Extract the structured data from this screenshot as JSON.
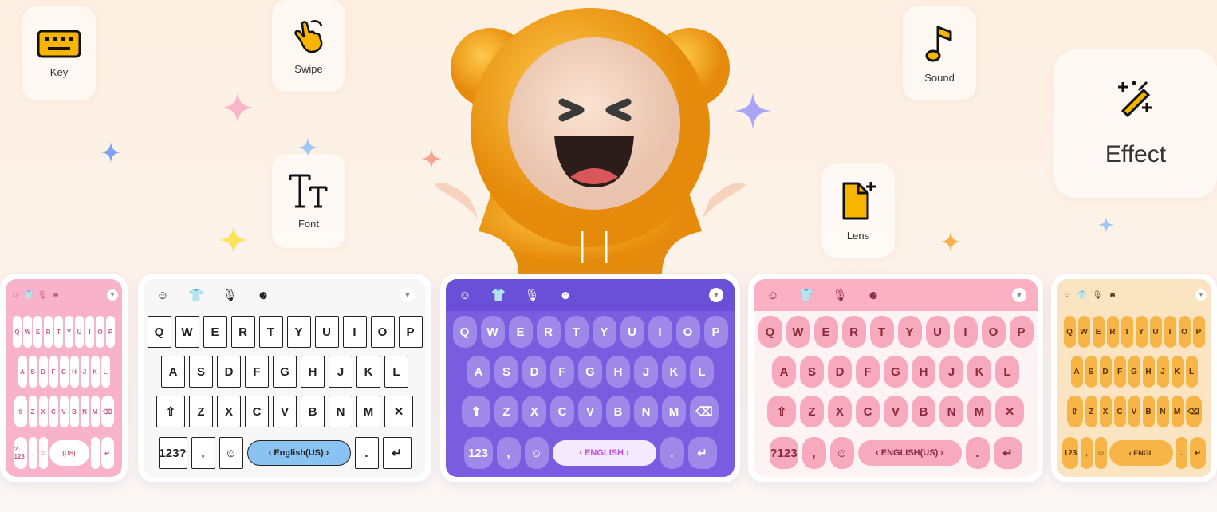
{
  "features": [
    {
      "label": "Key",
      "icon": "keyboard-icon"
    },
    {
      "label": "Swipe",
      "icon": "swipe-hand-icon"
    },
    {
      "label": "Font",
      "icon": "font-icon"
    },
    {
      "label": "Sound",
      "icon": "music-note-icon"
    },
    {
      "label": "Lens",
      "icon": "lens-file-icon"
    },
    {
      "label": "Effect",
      "icon": "magic-wand-icon"
    }
  ],
  "colors": {
    "accent": "#f7b500",
    "mascot": "#f5a623"
  },
  "keyboards": [
    {
      "name": "pink-bunny",
      "bg": "#f8b3cb",
      "key": "#ffffff",
      "text": "#c06080",
      "bar": "#f8b3cb",
      "space": "(US)",
      "shift": "⇧",
      "del": "⌫",
      "num": "?123",
      "comma": ",",
      "period": "."
    },
    {
      "name": "love-letter",
      "bg": "#f7f7f7",
      "key": "#ffffff",
      "text": "#222222",
      "bar": "#f7f7f7",
      "space": "‹ English(US) ›",
      "spacebg": "#8ac3f2",
      "shift": "⇧",
      "del": "✕",
      "num": "123?",
      "comma": ",",
      "period": "."
    },
    {
      "name": "purple-dream",
      "bg": "#7a5ce0",
      "key": "rgba(255,255,255,0.28)",
      "text": "#ffffff",
      "bar": "#6a4fd8",
      "space": "‹ ENGLISH ›",
      "spacebg": "#f3eaff",
      "spacetext": "#c050e0",
      "shift": "⬆",
      "del": "⌫",
      "num": "123",
      "comma": ",",
      "period": "."
    },
    {
      "name": "pink-cat",
      "bg": "#fdf3f5",
      "key": "#f7a9bd",
      "text": "#8a2a40",
      "bar": "#fcb0c4",
      "space": "‹ ENGLISH(US) ›",
      "spacebg": "#f7a9bd",
      "shift": "⇧",
      "del": "✕",
      "num": "?123",
      "comma": ",",
      "period": "."
    },
    {
      "name": "orange-cookie",
      "bg": "#fbe4c1",
      "key": "#f7b447",
      "text": "#5a3300",
      "bar": "#fbe4c1",
      "space": "‹ ENGL",
      "spacebg": "#f7b447",
      "shift": "⇧",
      "del": "⌫",
      "num": "123",
      "comma": ",",
      "period": "."
    }
  ],
  "rows": [
    "QWERTYUIOP",
    "ASDFGHJKL",
    "ZXCVBNM"
  ]
}
